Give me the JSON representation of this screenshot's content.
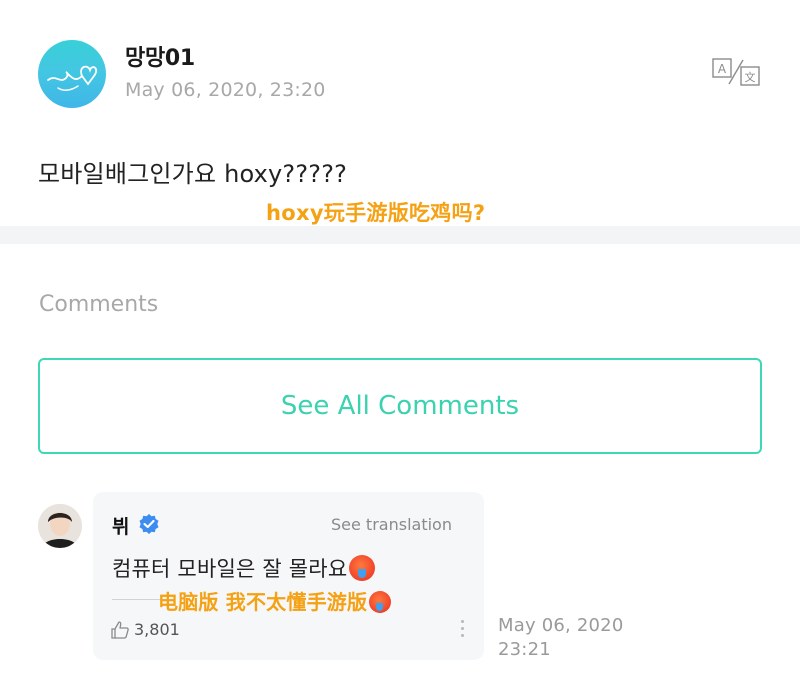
{
  "post": {
    "author_name": "망망01",
    "date": "May 06, 2020, 23:20",
    "body": "모바일배그인가요 hoxy?????",
    "caption": "hoxy玩手游版吃鸡吗?",
    "translate_icon": "translate-icon"
  },
  "comments_section": {
    "heading": "Comments",
    "see_all_label": "See All Comments"
  },
  "comment": {
    "author_name": "뷔",
    "verified_icon": "verified-check-icon",
    "see_translation_label": "See translation",
    "text": "컴퓨터 모바일은 잘 몰라요",
    "caption": "电脑版 我不太懂手游版",
    "emoji": "hot-face-emoji",
    "like_count": "3,801",
    "date_line1": "May 06, 2020",
    "date_line2": "23:21"
  },
  "colors": {
    "accent": "#3ed8b6",
    "caption_orange": "#f5a114",
    "muted_text": "#a8a8a8",
    "verified_blue": "#3d8cf0"
  }
}
